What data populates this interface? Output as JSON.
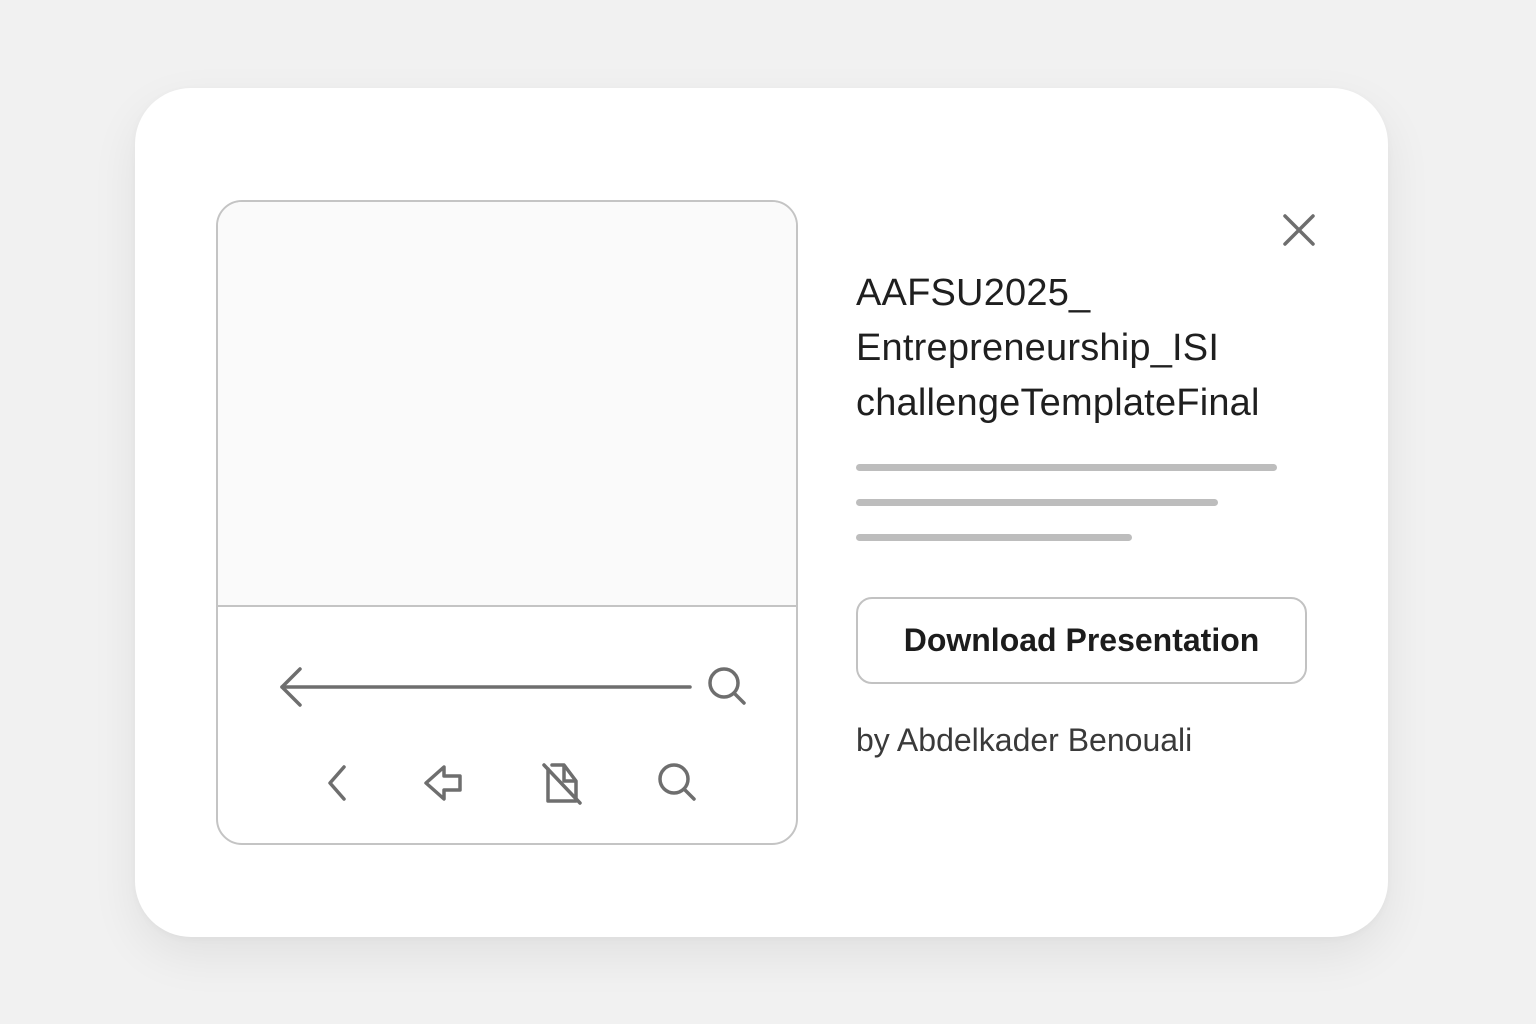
{
  "document": {
    "title_lines": [
      "AAFSU2025_",
      "Entrepreneurship_ISI",
      "challengeTemplateFinal"
    ],
    "author": "by Abdelkader Benouali"
  },
  "actions": {
    "download_label": "Download Presentation",
    "close_icon": "close-icon"
  },
  "preview": {
    "icons": [
      "back-arrow-icon",
      "search-icon",
      "chevron-left-icon",
      "arrow-left-outline-icon",
      "file-off-icon",
      "search-icon"
    ]
  },
  "colors": {
    "background": "#f1f1f1",
    "card": "#ffffff",
    "border": "#c4c4c4",
    "icon": "#6e6e6e",
    "text": "#1f1f1f",
    "skeleton": "#bdbdbd"
  }
}
